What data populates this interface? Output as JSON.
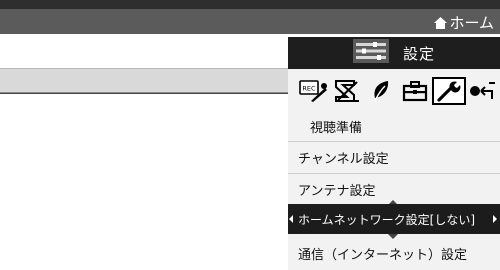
{
  "header": {
    "home_label": "ホーム"
  },
  "settings_panel": {
    "title": "設定",
    "icon_tabs": [
      {
        "name": "recording-settings-icon",
        "badge": "REC"
      },
      {
        "name": "display-settings-icon"
      },
      {
        "name": "eco-settings-icon"
      },
      {
        "name": "toolbox-settings-icon"
      },
      {
        "name": "wrench-settings-icon",
        "selected": true
      },
      {
        "name": "connection-settings-icon"
      }
    ],
    "category": "視聴準備",
    "items": [
      {
        "label": "チャンネル設定"
      },
      {
        "label": "アンテナ設定"
      },
      {
        "label": "ホームネットワーク設定[しない]",
        "selected": true
      },
      {
        "label": "通信（インターネット）設定"
      }
    ]
  },
  "colors": {
    "top_bar": "#5b5b5b",
    "panel_title_bg": "#1e1e1e",
    "panel_bg": "#f2f2f2",
    "selected_item_bg": "#1c1c1c"
  }
}
